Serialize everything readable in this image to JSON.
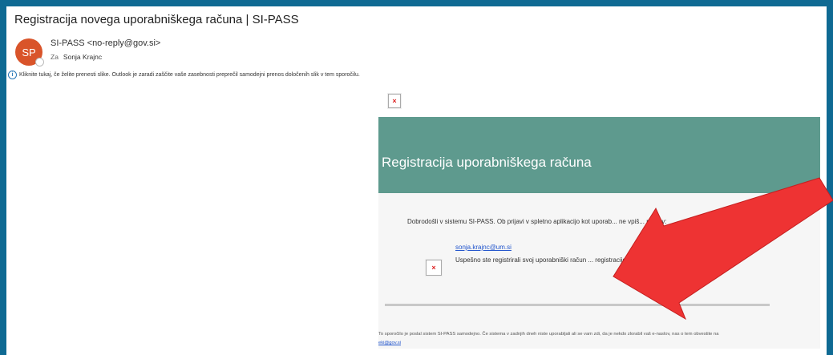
{
  "email": {
    "subject": "Registracija novega uporabniškega računa  | SI-PASS",
    "avatar_initials": "SP",
    "sender": "SI-PASS <no-reply@gov.si>",
    "recipient_label": "Za",
    "recipient_name": "Sonja Krajnc",
    "info_bar": "Kliknite tukaj, če želite prenesti slike. Outlook je zaradi zaščite vaše zasebnosti preprečil samodejni prenos določenih slik v tem sporočilu."
  },
  "body": {
    "banner_title": "Registracija uporabniškega računa",
    "welcome_text": "Dobrodošli v sistemu SI-PASS. Ob prijavi v spletno aplikacijo kot uporab... ne vpiš... naslov:",
    "email_link": "sonja.krajnc@um.si",
    "success_text": "Uspešno ste registrirali svoj uporabniški račun ... registracije je s tem zaključen.",
    "footer_text": "To sporočilo je poslal sistem SI-PASS samodejno. Če sistema v zadnjih dneh niste uporabljali ali se vam zdi, da je nekdo zlorabil vaš e-naslov, nas o tem obvestite na",
    "footer_link": "eki@gov.si"
  },
  "colors": {
    "frame_border": "#0f6a93",
    "banner": "#5e9a8e",
    "avatar": "#d9542a",
    "arrow": "#ee3333"
  }
}
